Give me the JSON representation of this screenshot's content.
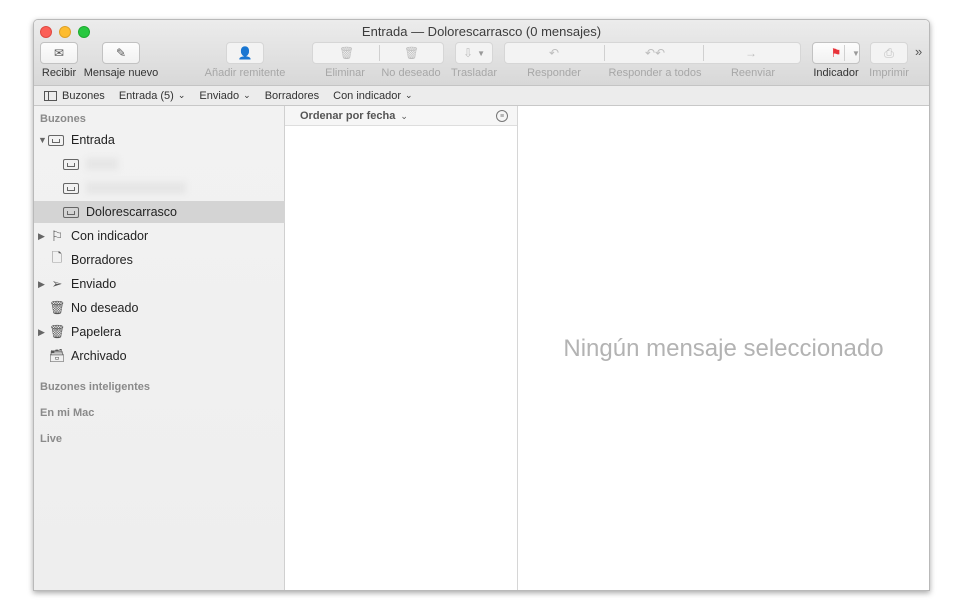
{
  "window": {
    "title": "Entrada — Dolorescarrasco (0 mensajes)"
  },
  "toolbar": {
    "receive": "Recibir",
    "new_message": "Mensaje nuevo",
    "add_sender": "Añadir remitente",
    "delete": "Eliminar",
    "junk": "No deseado",
    "move": "Trasladar",
    "reply": "Responder",
    "reply_all": "Responder a todos",
    "forward": "Reenviar",
    "flag": "Indicador",
    "print": "Imprimir",
    "more": "»"
  },
  "favorites": {
    "mailboxes": "Buzones",
    "inbox": "Entrada (5)",
    "sent": "Enviado",
    "drafts": "Borradores",
    "flagged": "Con indicador"
  },
  "sidebar": {
    "header_mailboxes": "Buzones",
    "inbox": "Entrada",
    "inbox_account_selected": "Dolorescarrasco",
    "flagged": "Con indicador",
    "drafts": "Borradores",
    "sent": "Enviado",
    "junk": "No deseado",
    "trash": "Papelera",
    "archive": "Archivado",
    "header_smart": "Buzones inteligentes",
    "header_on_my_mac": "En mi Mac",
    "header_live": "Live"
  },
  "message_list": {
    "sort_label": "Ordenar por fecha"
  },
  "preview": {
    "empty_text": "Ningún mensaje seleccionado"
  },
  "colors": {
    "flag": "#e8333a",
    "selected_row": "#d4d4d4"
  }
}
